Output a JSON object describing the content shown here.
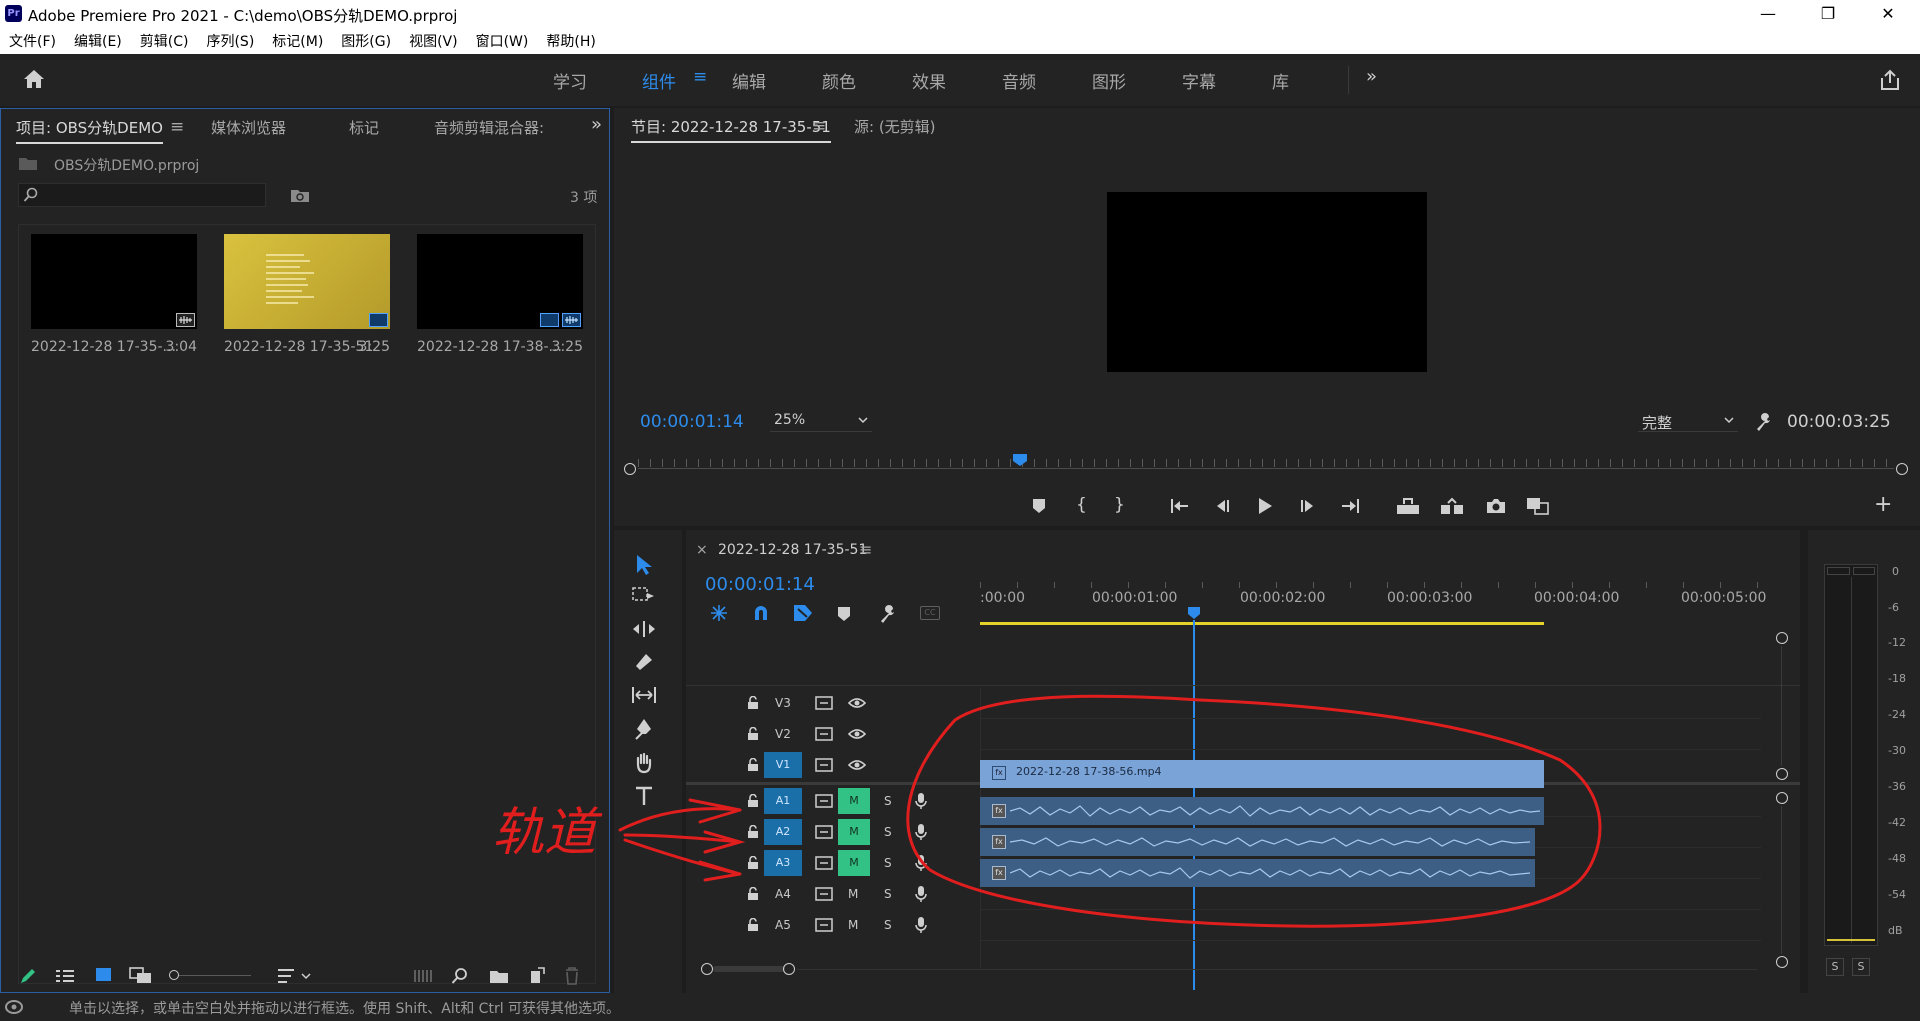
{
  "window": {
    "app_badge": "Pr",
    "title": "Adobe Premiere Pro 2021 - C:\\demo\\OBS分轨DEMO.prproj",
    "minimize": "—",
    "restore": "❐",
    "close": "✕"
  },
  "menu": [
    "文件(F)",
    "编辑(E)",
    "剪辑(C)",
    "序列(S)",
    "标记(M)",
    "图形(G)",
    "视图(V)",
    "窗口(W)",
    "帮助(H)"
  ],
  "workspaces": [
    "学习",
    "组件",
    "编辑",
    "颜色",
    "效果",
    "音频",
    "图形",
    "字幕",
    "库"
  ],
  "active_workspace": "组件",
  "project_panel": {
    "tabs": [
      "项目: OBS分轨DEMO",
      "媒体浏览器",
      "标记",
      "音频剪辑混合器:"
    ],
    "project_file": "OBS分轨DEMO.prproj",
    "item_count": "3 项",
    "items": [
      {
        "name": "2022-12-28 17-35-...",
        "duration": "3:04"
      },
      {
        "name": "2022-12-28 17-35-51",
        "duration": "3:25"
      },
      {
        "name": "2022-12-28 17-38-...",
        "duration": "3:25"
      }
    ]
  },
  "program_monitor": {
    "tabs": [
      "节目: 2022-12-28 17-35-51",
      "源: (无剪辑)"
    ],
    "current_time": "00:00:01:14",
    "zoom": "25%",
    "quality": "完整",
    "duration": "00:00:03:25"
  },
  "timeline": {
    "sequence_name": "2022-12-28 17-35-51",
    "current_time": "00:00:01:14",
    "ruler": [
      ":00:00",
      "00:00:01:00",
      "00:00:02:00",
      "00:00:03:00",
      "00:00:04:00",
      "00:00:05:00"
    ],
    "video_tracks": [
      "V3",
      "V2",
      "V1"
    ],
    "audio_tracks": [
      "A1",
      "A2",
      "A3",
      "A4",
      "A5"
    ],
    "clip_name": "2022-12-28 17-38-56.mp4",
    "mute_label": "M",
    "solo_label": "S"
  },
  "annotation": {
    "text": "轨道",
    "color": "#e01e1e"
  },
  "meter": {
    "scale": [
      "0",
      "-6",
      "-12",
      "-18",
      "-24",
      "-30",
      "-36",
      "-42",
      "-48",
      "-54",
      "dB"
    ],
    "solo": [
      "S",
      "S"
    ]
  },
  "status_bar": "单击以选择，或单击空白处并拖动以进行框选。使用 Shift、Alt和 Ctrl 可获得其他选项。"
}
